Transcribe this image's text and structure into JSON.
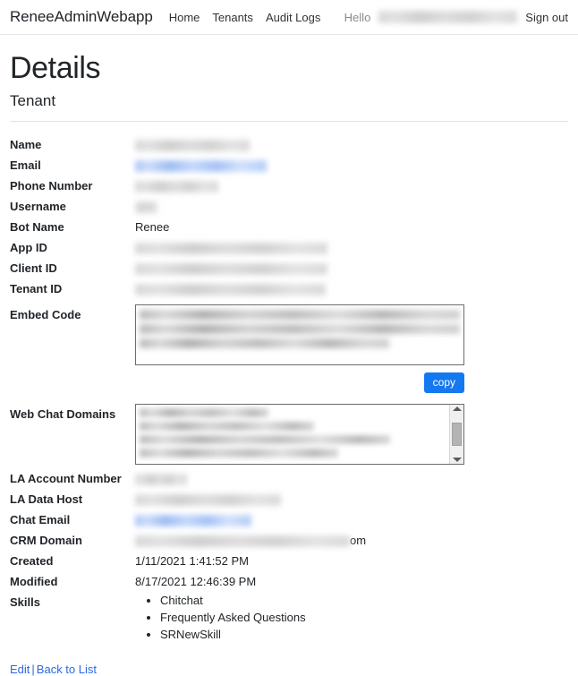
{
  "navbar": {
    "brand": "ReneeAdminWebapp",
    "links": [
      {
        "label": "Home"
      },
      {
        "label": "Tenants"
      },
      {
        "label": "Audit Logs"
      }
    ],
    "greeting": "Hello",
    "user_email_redacted": "redacted@company.com",
    "sign_out": "Sign out"
  },
  "page": {
    "title": "Details",
    "subtitle": "Tenant"
  },
  "fields": {
    "name_label": "Name",
    "name_value": "redacted",
    "email_label": "Email",
    "email_value": "redacted@company.com",
    "phone_label": "Phone Number",
    "phone_value": "redacted",
    "username_label": "Username",
    "username_value": "redacted",
    "bot_name_label": "Bot Name",
    "bot_name_value": "Renee",
    "app_id_label": "App ID",
    "app_id_value": "redacted",
    "client_id_label": "Client ID",
    "client_id_value": "redacted",
    "tenant_id_label": "Tenant ID",
    "tenant_id_value": "redacted",
    "embed_code_label": "Embed Code",
    "embed_code_value": "redacted",
    "copy_button": "copy",
    "web_chat_domains_label": "Web Chat Domains",
    "web_chat_domains_value": "redacted",
    "la_account_number_label": "LA Account Number",
    "la_account_number_value": "redacted",
    "la_data_host_label": "LA Data Host",
    "la_data_host_value": "redacted",
    "chat_email_label": "Chat Email",
    "chat_email_value": "redacted@gmail.com",
    "crm_domain_label": "CRM Domain",
    "crm_domain_value_redacted": "redacted",
    "crm_domain_value_tail": "om",
    "created_label": "Created",
    "created_value": "1/11/2021 1:41:52 PM",
    "modified_label": "Modified",
    "modified_value": "8/17/2021 12:46:39 PM",
    "skills_label": "Skills",
    "skills": [
      "Chitchat",
      "Frequently Asked Questions",
      "SRNewSkill"
    ]
  },
  "footer": {
    "edit": "Edit",
    "separator": "|",
    "back_to_list": "Back to List"
  },
  "colors": {
    "accent_blue": "#1479f0",
    "link_blue": "#2a6ae0"
  }
}
